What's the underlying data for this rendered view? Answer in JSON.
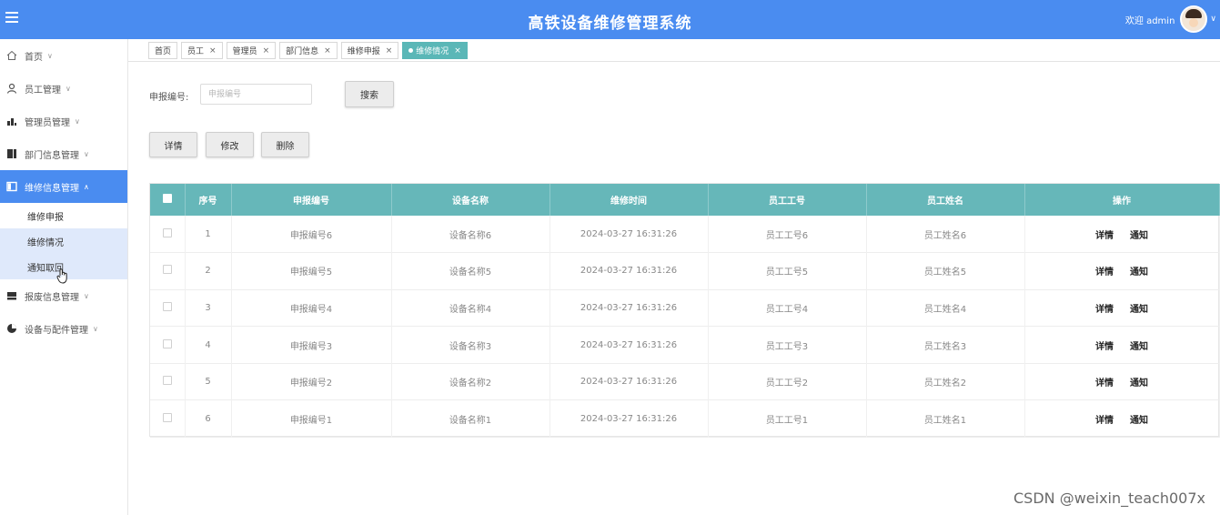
{
  "header": {
    "title": "高铁设备维修管理系统",
    "welcome": "欢迎 admin",
    "accent": "#4a8cf0"
  },
  "sidebar": {
    "items": [
      {
        "label": "首页",
        "icon": "home-icon"
      },
      {
        "label": "员工管理",
        "icon": "user-icon"
      },
      {
        "label": "管理员管理",
        "icon": "chart-icon"
      },
      {
        "label": "部门信息管理",
        "icon": "columns-icon"
      },
      {
        "label": "维修信息管理",
        "icon": "panel-icon"
      },
      {
        "label": "报废信息管理",
        "icon": "keyboard-icon"
      },
      {
        "label": "设备与配件管理",
        "icon": "pie-icon"
      }
    ],
    "sub_items": [
      "维修申报",
      "维修情况",
      "通知取回"
    ]
  },
  "tabs": [
    {
      "label": "首页",
      "closable": false
    },
    {
      "label": "员工",
      "closable": true
    },
    {
      "label": "管理员",
      "closable": true
    },
    {
      "label": "部门信息",
      "closable": true
    },
    {
      "label": "维修申报",
      "closable": true
    },
    {
      "label": "维修情况",
      "closable": true,
      "active": true
    }
  ],
  "search": {
    "label": "申报编号:",
    "placeholder": "申报编号",
    "button": "搜索"
  },
  "actions": {
    "detail": "详情",
    "edit": "修改",
    "delete": "删除"
  },
  "table": {
    "header_color": "#66b7b9",
    "columns": [
      "序号",
      "申报编号",
      "设备名称",
      "维修时间",
      "员工工号",
      "员工姓名",
      "操作"
    ],
    "rows": [
      {
        "index": "1",
        "code": "申报编号6",
        "device": "设备名称6",
        "time": "2024-03-27 16:31:26",
        "emp_no": "员工工号6",
        "emp_name": "员工姓名6"
      },
      {
        "index": "2",
        "code": "申报编号5",
        "device": "设备名称5",
        "time": "2024-03-27 16:31:26",
        "emp_no": "员工工号5",
        "emp_name": "员工姓名5"
      },
      {
        "index": "3",
        "code": "申报编号4",
        "device": "设备名称4",
        "time": "2024-03-27 16:31:26",
        "emp_no": "员工工号4",
        "emp_name": "员工姓名4"
      },
      {
        "index": "4",
        "code": "申报编号3",
        "device": "设备名称3",
        "time": "2024-03-27 16:31:26",
        "emp_no": "员工工号3",
        "emp_name": "员工姓名3"
      },
      {
        "index": "5",
        "code": "申报编号2",
        "device": "设备名称2",
        "time": "2024-03-27 16:31:26",
        "emp_no": "员工工号2",
        "emp_name": "员工姓名2"
      },
      {
        "index": "6",
        "code": "申报编号1",
        "device": "设备名称1",
        "time": "2024-03-27 16:31:26",
        "emp_no": "员工工号1",
        "emp_name": "员工姓名1"
      }
    ],
    "row_ops": [
      "详情",
      "通知"
    ]
  },
  "watermark": "CSDN @weixin_teach007x"
}
